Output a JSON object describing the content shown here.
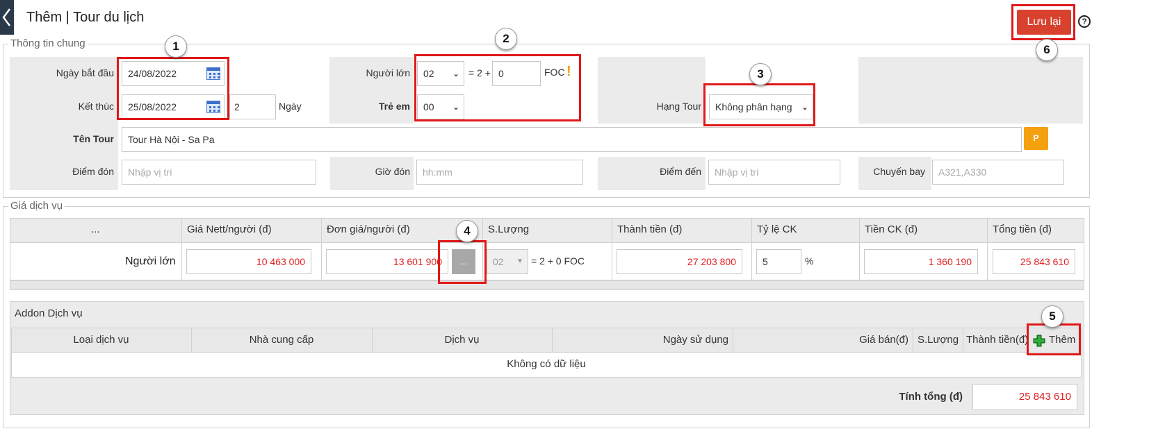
{
  "header": {
    "title": "Thêm | Tour du lịch",
    "save_label": "Lưu lại",
    "help_icon": "?"
  },
  "general": {
    "legend": "Thông tin chung",
    "start_date_label": "Ngày bắt đầu",
    "start_date": "24/08/2022",
    "end_date_label": "Kết thúc",
    "end_date": "25/08/2022",
    "days_value": "2",
    "days_unit": "Ngày",
    "adults_label": "Người lớn",
    "adults_value": "02",
    "adults_eq": "= 2 +",
    "foc_value": "0",
    "foc_label": "FOC",
    "warning_glyph": "!",
    "children_label": "Trẻ em",
    "children_value": "00",
    "tour_class_label": "Hạng Tour",
    "tour_class_value": "Không phân hạng",
    "tour_name_label": "Tên Tour",
    "tour_name_value": "Tour Hà Nội - Sa Pa",
    "p_button": "P",
    "pickup_label": "Điểm đón",
    "pickup_placeholder": "Nhập vị trí",
    "pickup_time_label": "Giờ đón",
    "pickup_time_placeholder": "hh:mm",
    "destination_label": "Điểm đến",
    "destination_placeholder": "Nhập vị trí",
    "flight_label": "Chuyến bay",
    "flight_placeholder": "A321,A330"
  },
  "pricing": {
    "legend": "Giá dịch vụ",
    "headers": [
      "...",
      "Giá Nett/người (đ)",
      "Đơn giá/người (đ)",
      "S.Lượng",
      "Thành tiền (đ)",
      "Tỷ lệ CK",
      "Tiền CK (đ)",
      "Tổng tiền (đ)"
    ],
    "row_label": "Người lớn",
    "nett_price": "10 463 000",
    "unit_price": "13 601 900",
    "more_button": "...",
    "quantity": "02",
    "quantity_note": "= 2 + 0 FOC",
    "line_total": "27 203 800",
    "discount_rate": "5",
    "percent": "%",
    "discount_amount": "1 360 190",
    "grand_total": "25 843 610"
  },
  "addon": {
    "title": "Addon Dịch vụ",
    "headers": [
      "Loại dịch vụ",
      "Nhà cung cấp",
      "Dịch vụ",
      "Ngày sử dụng",
      "Giá bán(đ)",
      "S.Lượng",
      "Thành tiền(đ)"
    ],
    "add_label": "Thêm",
    "empty_text": "Không có dữ liệu",
    "total_label": "Tính tổng (đ)",
    "total_value": "25 843 610"
  },
  "annotations": [
    "1",
    "2",
    "3",
    "4",
    "5",
    "6"
  ],
  "colors": {
    "accent_red": "#d9412f",
    "highlight_red": "#e01818",
    "money_red": "#e02020",
    "orange": "#f5a00f",
    "dark_nav": "#2b3a4a"
  }
}
